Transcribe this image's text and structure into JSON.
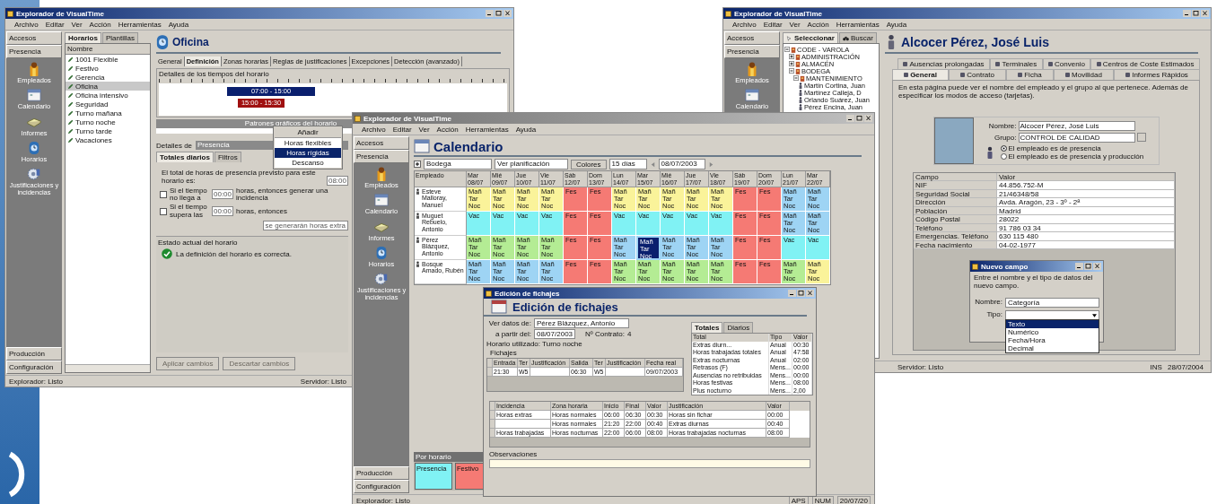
{
  "window_left": {
    "title": "Explorador de VisualTime",
    "menu": [
      "Archivo",
      "Editar",
      "Ver",
      "Acción",
      "Herramientas",
      "Ayuda"
    ],
    "nav": {
      "top": [
        "Accesos",
        "Presencia"
      ],
      "items": [
        {
          "label": "Empleados",
          "kind": "employees"
        },
        {
          "label": "Calendario",
          "kind": "calendar"
        },
        {
          "label": "Informes",
          "kind": "reports"
        },
        {
          "label": "Horarios",
          "kind": "schedules"
        },
        {
          "label": "Justificaciones y incidencias",
          "kind": "justifications"
        }
      ],
      "bottom": [
        "Producción",
        "Configuración"
      ]
    },
    "list_tabs": [
      {
        "label": "Horarios",
        "selected": true
      },
      {
        "label": "Plantillas",
        "selected": false
      }
    ],
    "list_header": "Nombre",
    "schedules": [
      {
        "name": "1001 Flexible",
        "selected": false
      },
      {
        "name": "Festivo",
        "selected": false
      },
      {
        "name": "Gerencia",
        "selected": false
      },
      {
        "name": "Oficina",
        "selected": true
      },
      {
        "name": "Oficina intensivo",
        "selected": false
      },
      {
        "name": "Seguridad",
        "selected": false
      },
      {
        "name": "Turno mañana",
        "selected": false
      },
      {
        "name": "Turno noche",
        "selected": false
      },
      {
        "name": "Turno tarde",
        "selected": false
      },
      {
        "name": "Vacaciones",
        "selected": false
      }
    ],
    "heading": "Oficina",
    "tabs": [
      {
        "label": "General",
        "selected": false
      },
      {
        "label": "Definición",
        "selected": true
      },
      {
        "label": "Zonas horarias",
        "selected": false
      },
      {
        "label": "Reglas de justificaciones",
        "selected": false
      },
      {
        "label": "Excepciones",
        "selected": false
      },
      {
        "label": "Detección (avanzado)",
        "selected": false
      }
    ],
    "timeline_title": "Detalles de los tiempos del horario",
    "timeline_bars": [
      {
        "label": "07:00 - 15:00",
        "color": "#0a1f6e"
      },
      {
        "label": "15:00 - 15:30",
        "color": "#a01010"
      }
    ],
    "pattern_header": "Patrones gráficos del horario",
    "context_menu": {
      "title": "Añadir",
      "items": [
        {
          "label": "Horas flexibles",
          "selected": false
        },
        {
          "label": "Horas rígidas",
          "selected": true
        },
        {
          "label": "Descanso",
          "selected": false
        }
      ]
    },
    "details_label": "Detalles de",
    "details_bar": "Presencia",
    "sub_tabs": [
      {
        "label": "Totales diarios",
        "selected": true
      },
      {
        "label": "Filtros",
        "selected": false
      }
    ],
    "total_text": "El total de horas de presencia previsto para este horario es:",
    "total_value": "08:00",
    "rules": [
      {
        "checked": false,
        "label": "Si el tiempo no llega a",
        "value": "00:00",
        "suffix": "horas, entonces generar una incidencia"
      },
      {
        "checked": false,
        "label": "Si el tiempo supera las",
        "value": "00:00",
        "suffix": "horas, entonces",
        "extra": "se generarán horas extra"
      }
    ],
    "status_title": "Estado actual del horario",
    "status_text": "La definición del horario es correcta.",
    "buttons": [
      {
        "label": "Aplicar cambios",
        "disabled": true
      },
      {
        "label": "Descartar cambios",
        "disabled": true
      }
    ],
    "status_bar": {
      "left": "Explorador: Listo",
      "right": "Servidor: Listo"
    }
  },
  "window_right": {
    "title": "Explorador de VisualTime",
    "menu": [
      "Archivo",
      "Editar",
      "Ver",
      "Acción",
      "Herramientas",
      "Ayuda"
    ],
    "nav": {
      "top": [
        "Accesos",
        "Presencia"
      ],
      "items": [
        {
          "label": "Empleados",
          "kind": "employees"
        },
        {
          "label": "Calendario",
          "kind": "calendar"
        }
      ]
    },
    "tree_tabs": [
      {
        "label": "Seleccionar",
        "selected": true
      },
      {
        "label": "Buscar",
        "selected": false
      }
    ],
    "tree": [
      {
        "label": "CODE - VAROLA",
        "expanded": true,
        "children": [
          {
            "label": "ADMINISTRACIÓN",
            "expanded": false
          },
          {
            "label": "ALMACÉN",
            "expanded": false
          },
          {
            "label": "BODEGA",
            "expanded": true,
            "children": [
              {
                "label": "MANTENIMIENTO",
                "expanded": true,
                "children": [
                  {
                    "label": "Martín Cortina, Juan"
                  },
                  {
                    "label": "Martínez Calleja, D"
                  },
                  {
                    "label": "Orlando Suárez, Juan"
                  },
                  {
                    "label": "Pérez Encina, Juan"
                  }
                ]
              }
            ]
          }
        ]
      }
    ],
    "heading": "Alcocer Pérez, José Luis",
    "tabs_back": [
      {
        "label": "Ausencias prolongadas",
        "selected": false
      },
      {
        "label": "Terminales",
        "selected": false
      },
      {
        "label": "Convenio",
        "selected": false
      },
      {
        "label": "Centros de Coste Estimados",
        "selected": false
      }
    ],
    "tabs_front": [
      {
        "label": "General",
        "selected": true
      },
      {
        "label": "Contrato",
        "selected": false
      },
      {
        "label": "Ficha",
        "selected": false
      },
      {
        "label": "Movilidad",
        "selected": false
      },
      {
        "label": "Informes Rápidos",
        "selected": false
      }
    ],
    "description": "En esta página puede ver el nombre del empleado y el grupo al que pertenece. Además de especificar los modos de acceso (tarjetas).",
    "name_label": "Nombre:",
    "name_value": "Alcocer Pérez, José Luis",
    "group_label": "Grupo:",
    "group_value": "CONTROL DE CALIDAD",
    "employee_types": [
      {
        "label": "El empleado es de presencia",
        "selected": true
      },
      {
        "label": "El empleado es de presencia y producción",
        "selected": false
      }
    ],
    "fields_columns": [
      "Campo",
      "Valor"
    ],
    "fields": [
      [
        "NIF",
        "44.856.752-M"
      ],
      [
        "Seguridad Social",
        "21/46348/58"
      ],
      [
        "Dirección",
        "Avda. Aragón, 23 - 3º - 2ª"
      ],
      [
        "Población",
        "Madrid"
      ],
      [
        "Código Postal",
        "28022"
      ],
      [
        "Teléfono",
        "91 786 03 34"
      ],
      [
        "Emergencias. Teléfono",
        "630 115 480"
      ],
      [
        "Fecha nacimiento",
        "04-02-1977"
      ]
    ],
    "status_bar": {
      "center": "Servidor: Listo",
      "ins": "INS",
      "date": "28/07/2004"
    }
  },
  "new_field_dialog": {
    "title": "Nuevo campo",
    "text": "Entre el nombre y el tipo de datos del nuevo campo.",
    "name_label": "Nombre:",
    "name_value": "Categoría",
    "type_label": "Tipo:",
    "type_options": [
      {
        "label": "Texto",
        "selected": true
      },
      {
        "label": "Numérico",
        "selected": false
      },
      {
        "label": "Fecha/Hora",
        "selected": false
      },
      {
        "label": "Decimal",
        "selected": false
      }
    ]
  },
  "window_middle": {
    "title": "Explorador de VisualTime",
    "menu": [
      "Archivo",
      "Editar",
      "Ver",
      "Acción",
      "Herramientas",
      "Ayuda"
    ],
    "nav": {
      "top": [
        "Accesos",
        "Presencia"
      ],
      "items": [
        {
          "label": "Empleados",
          "kind": "employees"
        },
        {
          "label": "Calendario",
          "kind": "calendar"
        },
        {
          "label": "Informes",
          "kind": "reports"
        },
        {
          "label": "Horarios",
          "kind": "schedules"
        },
        {
          "label": "Justificaciones y incidencias",
          "kind": "justifications"
        }
      ],
      "bottom": [
        "Producción",
        "Configuración"
      ]
    },
    "heading": "Calendario",
    "toolbar": {
      "group": "Bodega",
      "view": "Ver planificación",
      "colors_button": "Colores",
      "range": "15 días",
      "date": "08/07/2003"
    },
    "calendar": {
      "employee_column": "Empleado",
      "days": [
        [
          "Mar",
          "08/07"
        ],
        [
          "Mié",
          "09/07"
        ],
        [
          "Jue",
          "10/07"
        ],
        [
          "Vie",
          "11/07"
        ],
        [
          "Sáb",
          "12/07"
        ],
        [
          "Dom",
          "13/07"
        ],
        [
          "Lun",
          "14/07"
        ],
        [
          "Mar",
          "15/07"
        ],
        [
          "Mié",
          "16/07"
        ],
        [
          "Jue",
          "17/07"
        ],
        [
          "Vie",
          "18/07"
        ],
        [
          "Sáb",
          "19/07"
        ],
        [
          "Dom",
          "20/07"
        ],
        [
          "Lun",
          "21/07"
        ],
        [
          "Mar",
          "22/07"
        ]
      ],
      "rows": [
        {
          "employee": "Esteve Malloray, Manuel",
          "cells": [
            {
              "lines": [
                "Mañ",
                "Tar",
                "Noc"
              ],
              "color": "#faf39a",
              "selected": false
            },
            {
              "lines": [
                "Mañ",
                "Tar",
                "Noc"
              ],
              "color": "#faf39a",
              "selected": false
            },
            {
              "lines": [
                "Mañ",
                "Tar",
                "Noc"
              ],
              "color": "#faf39a",
              "selected": false
            },
            {
              "lines": [
                "Mañ",
                "Tar",
                "Noc"
              ],
              "color": "#faf39a",
              "selected": false
            },
            {
              "lines": [
                "Fes"
              ],
              "color": "#f57a74",
              "selected": false
            },
            {
              "lines": [
                "Fes"
              ],
              "color": "#f57a74",
              "selected": false
            },
            {
              "lines": [
                "Mañ",
                "Tar",
                "Noc"
              ],
              "color": "#faf39a",
              "selected": false
            },
            {
              "lines": [
                "Mañ",
                "Tar",
                "Noc"
              ],
              "color": "#faf39a",
              "selected": false
            },
            {
              "lines": [
                "Mañ",
                "Tar",
                "Noc"
              ],
              "color": "#faf39a",
              "selected": false
            },
            {
              "lines": [
                "Mañ",
                "Tar",
                "Noc"
              ],
              "color": "#faf39a",
              "selected": false
            },
            {
              "lines": [
                "Mañ",
                "Tar",
                "Noc"
              ],
              "color": "#faf39a",
              "selected": false
            },
            {
              "lines": [
                "Fes"
              ],
              "color": "#f57a74",
              "selected": false
            },
            {
              "lines": [
                "Fes"
              ],
              "color": "#f57a74",
              "selected": false
            },
            {
              "lines": [
                "Mañ",
                "Tar",
                "Noc"
              ],
              "color": "#9ed4f4",
              "selected": false
            },
            {
              "lines": [
                "Mañ",
                "Tar",
                "Noc"
              ],
              "color": "#9ed4f4",
              "selected": false
            }
          ]
        },
        {
          "employee": "Muguet Rebuelo, Antonio",
          "cells": [
            {
              "lines": [
                "Vac"
              ],
              "color": "#80f2f4",
              "selected": false
            },
            {
              "lines": [
                "Vac"
              ],
              "color": "#80f2f4",
              "selected": false
            },
            {
              "lines": [
                "Vac"
              ],
              "color": "#80f2f4",
              "selected": false
            },
            {
              "lines": [
                "Vac"
              ],
              "color": "#80f2f4",
              "selected": false
            },
            {
              "lines": [
                "Fes"
              ],
              "color": "#f57a74",
              "selected": false
            },
            {
              "lines": [
                "Fes"
              ],
              "color": "#f57a74",
              "selected": false
            },
            {
              "lines": [
                "Vac"
              ],
              "color": "#80f2f4",
              "selected": false
            },
            {
              "lines": [
                "Vac"
              ],
              "color": "#80f2f4",
              "selected": false
            },
            {
              "lines": [
                "Vac"
              ],
              "color": "#80f2f4",
              "selected": false
            },
            {
              "lines": [
                "Vac"
              ],
              "color": "#80f2f4",
              "selected": false
            },
            {
              "lines": [
                "Vac"
              ],
              "color": "#80f2f4",
              "selected": false
            },
            {
              "lines": [
                "Fes"
              ],
              "color": "#f57a74",
              "selected": false
            },
            {
              "lines": [
                "Fes"
              ],
              "color": "#f57a74",
              "selected": false
            },
            {
              "lines": [
                "Mañ",
                "Tar",
                "Noc"
              ],
              "color": "#9ed4f4",
              "selected": false
            },
            {
              "lines": [
                "Mañ",
                "Tar",
                "Noc"
              ],
              "color": "#9ed4f4",
              "selected": false
            }
          ]
        },
        {
          "employee": "Pérez Blázquez, Antonio",
          "cells": [
            {
              "lines": [
                "Mañ",
                "Tar",
                "Noc"
              ],
              "color": "#b4ec94",
              "selected": false
            },
            {
              "lines": [
                "Mañ",
                "Tar",
                "Noc"
              ],
              "color": "#b4ec94",
              "selected": false
            },
            {
              "lines": [
                "Mañ",
                "Tar",
                "Noc"
              ],
              "color": "#b4ec94",
              "selected": false
            },
            {
              "lines": [
                "Mañ",
                "Tar",
                "Noc"
              ],
              "color": "#b4ec94",
              "selected": false
            },
            {
              "lines": [
                "Fes"
              ],
              "color": "#f57a74",
              "selected": false
            },
            {
              "lines": [
                "Fes"
              ],
              "color": "#f57a74",
              "selected": false
            },
            {
              "lines": [
                "Mañ",
                "Tar",
                "Noc"
              ],
              "color": "#9ed4f4",
              "selected": false
            },
            {
              "lines": [
                "Mañ",
                "Tar",
                "Noc"
              ],
              "color": "#9ed4f4",
              "selected": true
            },
            {
              "lines": [
                "Mañ",
                "Tar",
                "Noc"
              ],
              "color": "#9ed4f4",
              "selected": false
            },
            {
              "lines": [
                "Mañ",
                "Tar",
                "Noc"
              ],
              "color": "#9ed4f4",
              "selected": false
            },
            {
              "lines": [
                "Mañ",
                "Tar",
                "Noc"
              ],
              "color": "#9ed4f4",
              "selected": false
            },
            {
              "lines": [
                "Fes"
              ],
              "color": "#f57a74",
              "selected": false
            },
            {
              "lines": [
                "Fes"
              ],
              "color": "#f57a74",
              "selected": false
            },
            {
              "lines": [
                "Vac"
              ],
              "color": "#80f2f4",
              "selected": false
            },
            {
              "lines": [
                "Vac"
              ],
              "color": "#80f2f4",
              "selected": false
            }
          ]
        },
        {
          "employee": "Bosque Amado, Rubén",
          "cells": [
            {
              "lines": [
                "Mañ",
                "Tar",
                "Noc"
              ],
              "color": "#9ed4f4",
              "selected": false
            },
            {
              "lines": [
                "Mañ",
                "Tar",
                "Noc"
              ],
              "color": "#9ed4f4",
              "selected": false
            },
            {
              "lines": [
                "Mañ",
                "Tar",
                "Noc"
              ],
              "color": "#9ed4f4",
              "selected": false
            },
            {
              "lines": [
                "Mañ",
                "Tar",
                "Noc"
              ],
              "color": "#9ed4f4",
              "selected": false
            },
            {
              "lines": [
                "Fes"
              ],
              "color": "#f57a74",
              "selected": false
            },
            {
              "lines": [
                "Fes"
              ],
              "color": "#f57a74",
              "selected": false
            },
            {
              "lines": [
                "Mañ",
                "Tar",
                "Noc"
              ],
              "color": "#b4ec94",
              "selected": false
            },
            {
              "lines": [
                "Mañ",
                "Tar",
                "Noc"
              ],
              "color": "#b4ec94",
              "selected": false
            },
            {
              "lines": [
                "Mañ",
                "Tar",
                "Noc"
              ],
              "color": "#b4ec94",
              "selected": false
            },
            {
              "lines": [
                "Mañ",
                "Tar",
                "Noc"
              ],
              "color": "#b4ec94",
              "selected": false
            },
            {
              "lines": [
                "Mañ",
                "Tar",
                "Noc"
              ],
              "color": "#b4ec94",
              "selected": false
            },
            {
              "lines": [
                "Fes"
              ],
              "color": "#f57a74",
              "selected": false
            },
            {
              "lines": [
                "Fes"
              ],
              "color": "#f57a74",
              "selected": false
            },
            {
              "lines": [
                "Mañ",
                "Tar",
                "Noc"
              ],
              "color": "#b4ec94",
              "selected": false
            },
            {
              "lines": [
                "Mañ",
                "Tar",
                "Noc"
              ],
              "color": "#faf39a",
              "selected": false
            }
          ]
        }
      ]
    },
    "legend": {
      "title": "Por horario",
      "items": [
        {
          "label": "Presencia",
          "color": "#80f2f4"
        },
        {
          "label": "Festivo",
          "color": "#f57a74"
        }
      ]
    },
    "status_bar": {
      "left": "Explorador: Listo",
      "indicators": [
        "APS",
        "NUM",
        "20/07/20"
      ]
    }
  },
  "edit_dialog": {
    "title": "Edición de fichajes",
    "heading": "Edición de fichajes",
    "employee_label": "Ver datos de:",
    "employee_value": "Pérez Blázquez, Antonio",
    "date_label": "a partir del:",
    "date_value": "08/07/2003",
    "contract_label": "Nº Contrato:",
    "contract_value": "4",
    "schedule_text": "Horario utilizado: Turno noche",
    "punches_label": "Fichajes",
    "punches_columns": {
      "in": "Entrada",
      "in_terminal": "Ter",
      "in_reason": "Justificación",
      "out": "Salida",
      "out_terminal": "Ter",
      "out_reason": "Justificación",
      "real_date": "Fecha real"
    },
    "punches": [
      {
        "in": "21:30",
        "in_terminal": "W5",
        "out": "06:30",
        "out_terminal": "W5",
        "real_date": "09/07/2003"
      }
    ],
    "totals_tabs": [
      {
        "label": "Totales",
        "selected": true
      },
      {
        "label": "Diarios",
        "selected": false
      }
    ],
    "totals_columns": [
      "Total",
      "Tipo",
      "Valor"
    ],
    "totals": [
      [
        "Extras diurn...",
        "Anual",
        "00:30"
      ],
      [
        "Horas trabajadas totales",
        "Anual",
        "47:58"
      ],
      [
        "Extras nocturnas",
        "Anual",
        "02:00"
      ],
      [
        "Retrasos (F)",
        "Mens...",
        "00:00"
      ],
      [
        "Ausencias no retribuidas",
        "Mens...",
        "00:00"
      ],
      [
        "Horas festivas",
        "Mens...",
        "08:00"
      ],
      [
        "Plus nocturno",
        "Mens...",
        "2,00"
      ]
    ],
    "incidents_columns": {
      "incident": "Incidencia",
      "zone": "Zona horaria",
      "start": "Inicio",
      "end": "Final",
      "value": "Valor",
      "reason": "Justificación",
      "total": "Valor"
    },
    "incidents": [
      {
        "incident": "Horas extras",
        "zone": "Horas normales",
        "start": "06:00",
        "end": "06:30",
        "value": "00:30",
        "reason": "Horas sin fichar",
        "total": "00:00"
      },
      {
        "zone": "Horas normales",
        "start": "21:20",
        "end": "22:00",
        "value": "00:40",
        "reason": "Extras diurnas",
        "total": "00:40"
      },
      {
        "incident": "Horas trabajadas",
        "zone": "Horas nocturnas",
        "start": "22:00",
        "end": "06:00",
        "value": "08:00",
        "reason": "Horas trabajadas nocturnas",
        "total": "08:00"
      }
    ],
    "notes_label": "Observaciones"
  }
}
